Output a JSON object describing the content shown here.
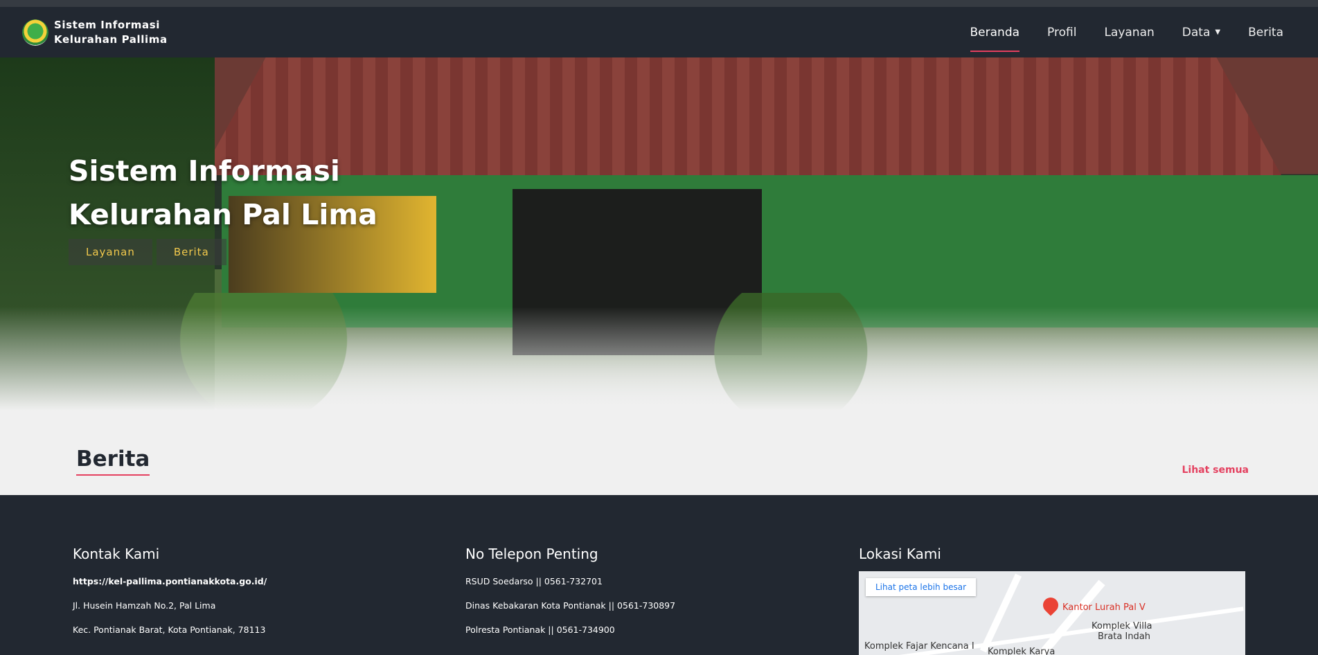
{
  "brand": {
    "line1": "Sistem Informasi",
    "line2": "Kelurahan Pallima"
  },
  "nav": {
    "items": [
      {
        "label": "Beranda",
        "active": true
      },
      {
        "label": "Profil"
      },
      {
        "label": "Layanan"
      },
      {
        "label": "Data",
        "dropdown": true
      },
      {
        "label": "Berita"
      }
    ],
    "dropdown_caret": "▼"
  },
  "hero": {
    "title_line1": "Sistem Informasi",
    "title_line2": "Kelurahan Pal Lima",
    "buttons": [
      {
        "label": "Layanan"
      },
      {
        "label": "Berita"
      }
    ]
  },
  "berita": {
    "title": "Berita",
    "see_all": "Lihat semua"
  },
  "footer": {
    "contact": {
      "title": "Kontak Kami",
      "lines": [
        "https://kel-pallima.pontianakkota.go.id/",
        "Jl. Husein Hamzah No.2, Pal Lima",
        "Kec. Pontianak Barat, Kota Pontianak, 78113"
      ]
    },
    "phones": {
      "title": "No Telepon Penting",
      "lines": [
        "RSUD Soedarso || 0561-732701",
        "Dinas Kebakaran Kota Pontianak || 0561-730897",
        "Polresta Pontianak || 0561-734900"
      ]
    },
    "location": {
      "title": "Lokasi Kami",
      "map_button": "Lihat peta lebih besar",
      "labels": [
        "Kantor Lurah Pal V",
        "Komplek Villa",
        "Brata Indah",
        "Komplek Fajar Kencana I",
        "Komplek Karya"
      ]
    }
  },
  "colors": {
    "accent": "#e4405f",
    "dark": "#222831",
    "hero_button_text": "#f2c94c"
  }
}
